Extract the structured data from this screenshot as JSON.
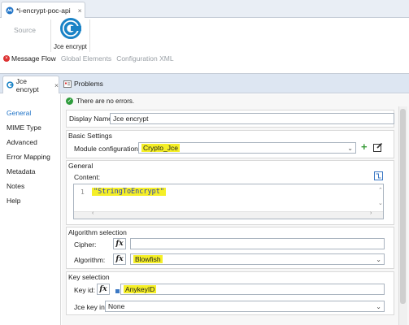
{
  "editor_tab": {
    "title": "*i-encrypt-poc-api",
    "close": "×"
  },
  "palette": {
    "source_label": "Source",
    "jce_label": "Jce encrypt"
  },
  "view_tabs": [
    {
      "label": "Message Flow",
      "active": true
    },
    {
      "label": "Global Elements",
      "active": false
    },
    {
      "label": "Configuration XML",
      "active": false
    }
  ],
  "prop_tabs": {
    "jce": "Jce encrypt",
    "jce_close": "×",
    "problems": "Problems"
  },
  "nav": [
    "General",
    "MIME Type",
    "Advanced",
    "Error Mapping",
    "Metadata",
    "Notes",
    "Help"
  ],
  "status": {
    "text": "There are no errors.",
    "icon": "check-icon"
  },
  "display_name": {
    "label": "Display Name:",
    "value": "Jce encrypt"
  },
  "basic": {
    "title": "Basic Settings",
    "module_label": "Module configuration:",
    "module_value": "Crypto_Jce"
  },
  "general": {
    "title": "General",
    "content_label": "Content:",
    "line_no": "1",
    "code": "\"StringToEncrypt\""
  },
  "algorithm": {
    "title": "Algorithm selection",
    "cipher_label": "Cipher:",
    "cipher_value": "",
    "algorithm_label": "Algorithm:",
    "algorithm_value": "Blowfish",
    "fx": "fx"
  },
  "key": {
    "title": "Key selection",
    "keyid_label": "Key id:",
    "keyid_value": "AnykeyID",
    "keyinfo_label": "Jce key info",
    "keyinfo_value": "None",
    "fx": "fx"
  },
  "colors": {
    "highlight": "#f5ef27",
    "accent": "#1f73c7",
    "ok": "#2e9c3c"
  }
}
